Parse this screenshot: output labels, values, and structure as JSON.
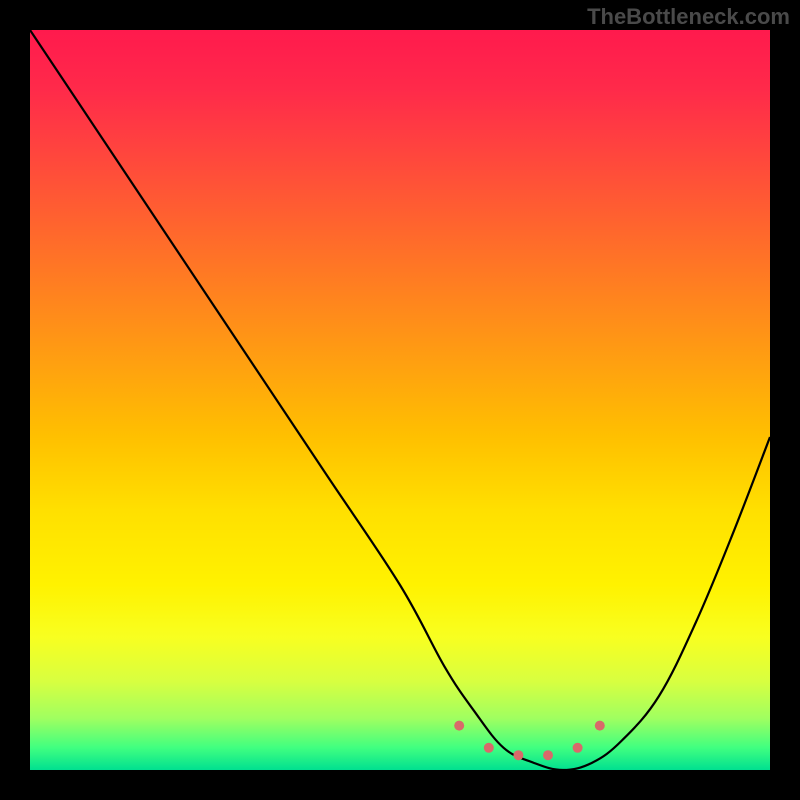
{
  "watermark": "TheBottleneck.com",
  "chart_data": {
    "type": "line",
    "title": "",
    "xlabel": "",
    "ylabel": "",
    "xlim": [
      0,
      100
    ],
    "ylim": [
      0,
      100
    ],
    "gradient_stops": [
      {
        "pos": 0,
        "color": "#ff1a4d"
      },
      {
        "pos": 50,
        "color": "#ffc000"
      },
      {
        "pos": 85,
        "color": "#f0ff30"
      },
      {
        "pos": 100,
        "color": "#00e090"
      }
    ],
    "series": [
      {
        "name": "curve",
        "color": "#000000",
        "x": [
          0,
          10,
          20,
          30,
          40,
          50,
          56,
          60,
          64,
          68,
          72,
          76,
          80,
          85,
          90,
          95,
          100
        ],
        "values": [
          100,
          85,
          70,
          55,
          40,
          25,
          14,
          8,
          3,
          1,
          0,
          1,
          4,
          10,
          20,
          32,
          45
        ]
      }
    ],
    "markers": {
      "color": "#d86a6a",
      "radius": 5,
      "points": [
        {
          "x": 58,
          "y": 6
        },
        {
          "x": 62,
          "y": 3
        },
        {
          "x": 66,
          "y": 2
        },
        {
          "x": 70,
          "y": 2
        },
        {
          "x": 74,
          "y": 3
        },
        {
          "x": 77,
          "y": 6
        }
      ]
    }
  }
}
